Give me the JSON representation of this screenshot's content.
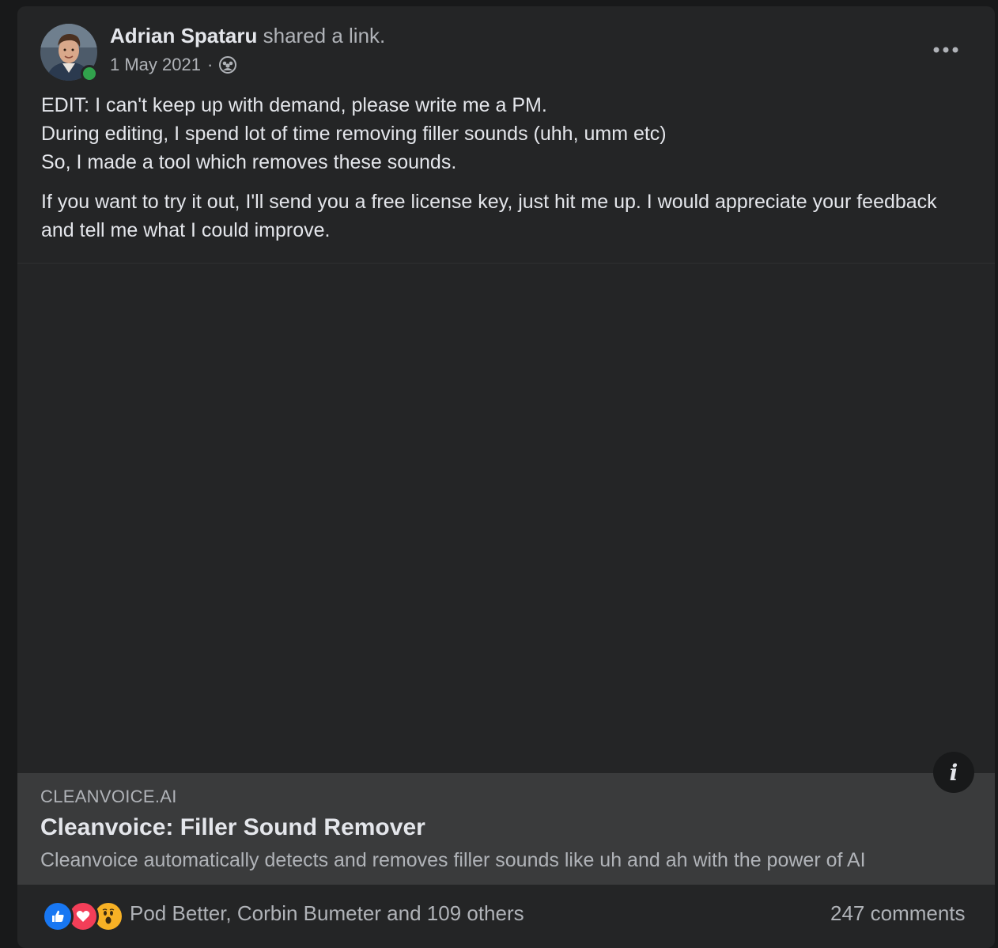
{
  "post": {
    "author_name": "Adrian Spataru",
    "action_text": "shared a link.",
    "date": "1 May 2021",
    "separator": "·",
    "audience_icon": "group-icon",
    "more_icon": "more-horizontal-icon",
    "text_lines": [
      "EDIT: I can't keep up with demand, please write me a PM.",
      "During editing, I spend lot of time removing filler sounds (uhh, umm etc)",
      "So, I made a tool which removes these sounds."
    ],
    "text_paragraph_2": "If you want to try it out,  I'll send you a free license key, just hit me up. I would appreciate your feedback and tell me what I could improve."
  },
  "link_preview": {
    "domain": "CLEANVOICE.AI",
    "title": "Cleanvoice: Filler Sound Remover",
    "description": "Cleanvoice automatically detects and removes filler sounds like uh and ah with the power of AI",
    "info_glyph": "i"
  },
  "footer": {
    "reaction_icons": [
      "like-icon",
      "love-icon",
      "wow-icon"
    ],
    "reactors_text": "Pod Better, Corbin Bumeter and 109 others",
    "comments_text": "247 comments"
  },
  "colors": {
    "card_bg": "#242526",
    "page_bg": "#18191a",
    "preview_bg": "#3a3b3c",
    "primary_text": "#e4e6eb",
    "secondary_text": "#b0b3b8",
    "like_blue": "#1877f2",
    "love_red": "#f33e58",
    "wow_yellow": "#f7b125",
    "online_green": "#31a24c"
  }
}
